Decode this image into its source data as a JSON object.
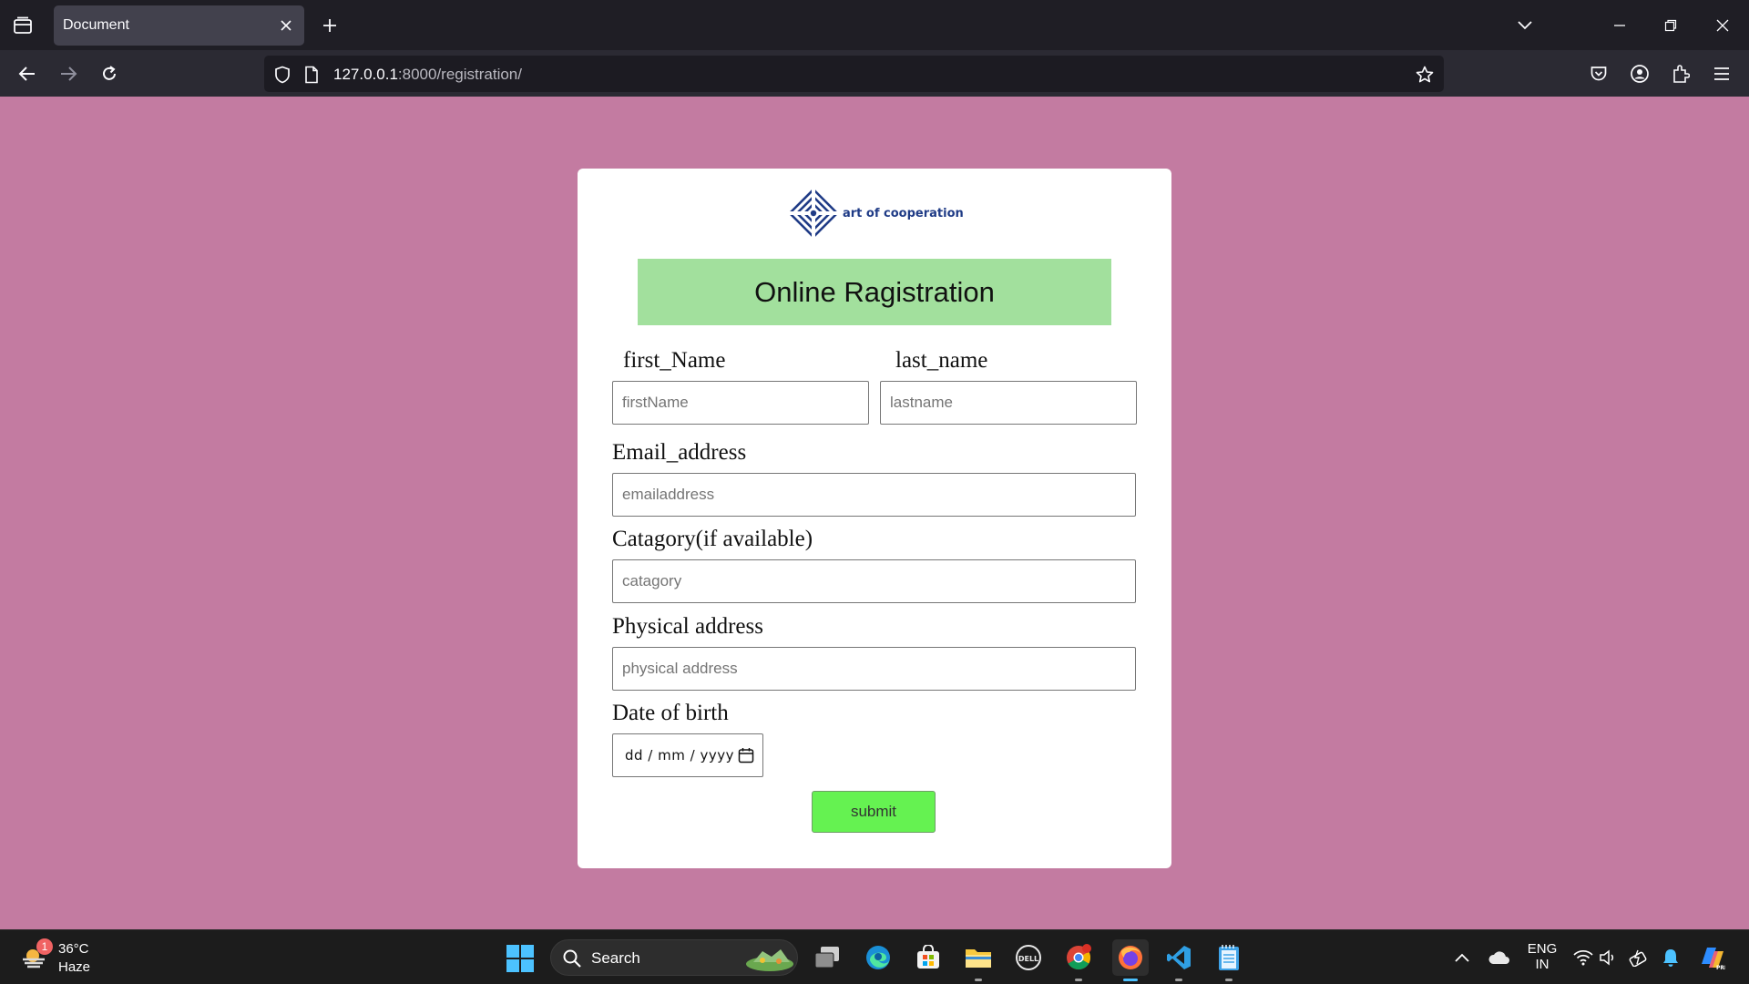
{
  "browser": {
    "tab_title": "Document",
    "url_host": "127.0.0.1",
    "url_path": ":8000/registration/"
  },
  "page": {
    "logo_text": "art of cooperation",
    "heading": "Online Ragistration",
    "labels": {
      "first_name": "first_Name",
      "last_name": "last_name",
      "email": "Email_address",
      "category": "Catagory(if available)",
      "physical": "Physical address",
      "dob": "Date of birth"
    },
    "placeholders": {
      "first_name": "firstName",
      "last_name": "lastname",
      "email": "emailaddress",
      "category": "catagory",
      "physical": "physical address"
    },
    "date_placeholder": "dd / mm / yyyy",
    "submit_label": "submit",
    "colors": {
      "background": "#c37ba1",
      "heading_box": "#a2e09d",
      "submit_button": "#65f251"
    }
  },
  "taskbar": {
    "weather_badge": "1",
    "weather_temp": "36°C",
    "weather_desc": "Haze",
    "search_label": "Search",
    "lang_top": "ENG",
    "lang_bottom": "IN"
  }
}
